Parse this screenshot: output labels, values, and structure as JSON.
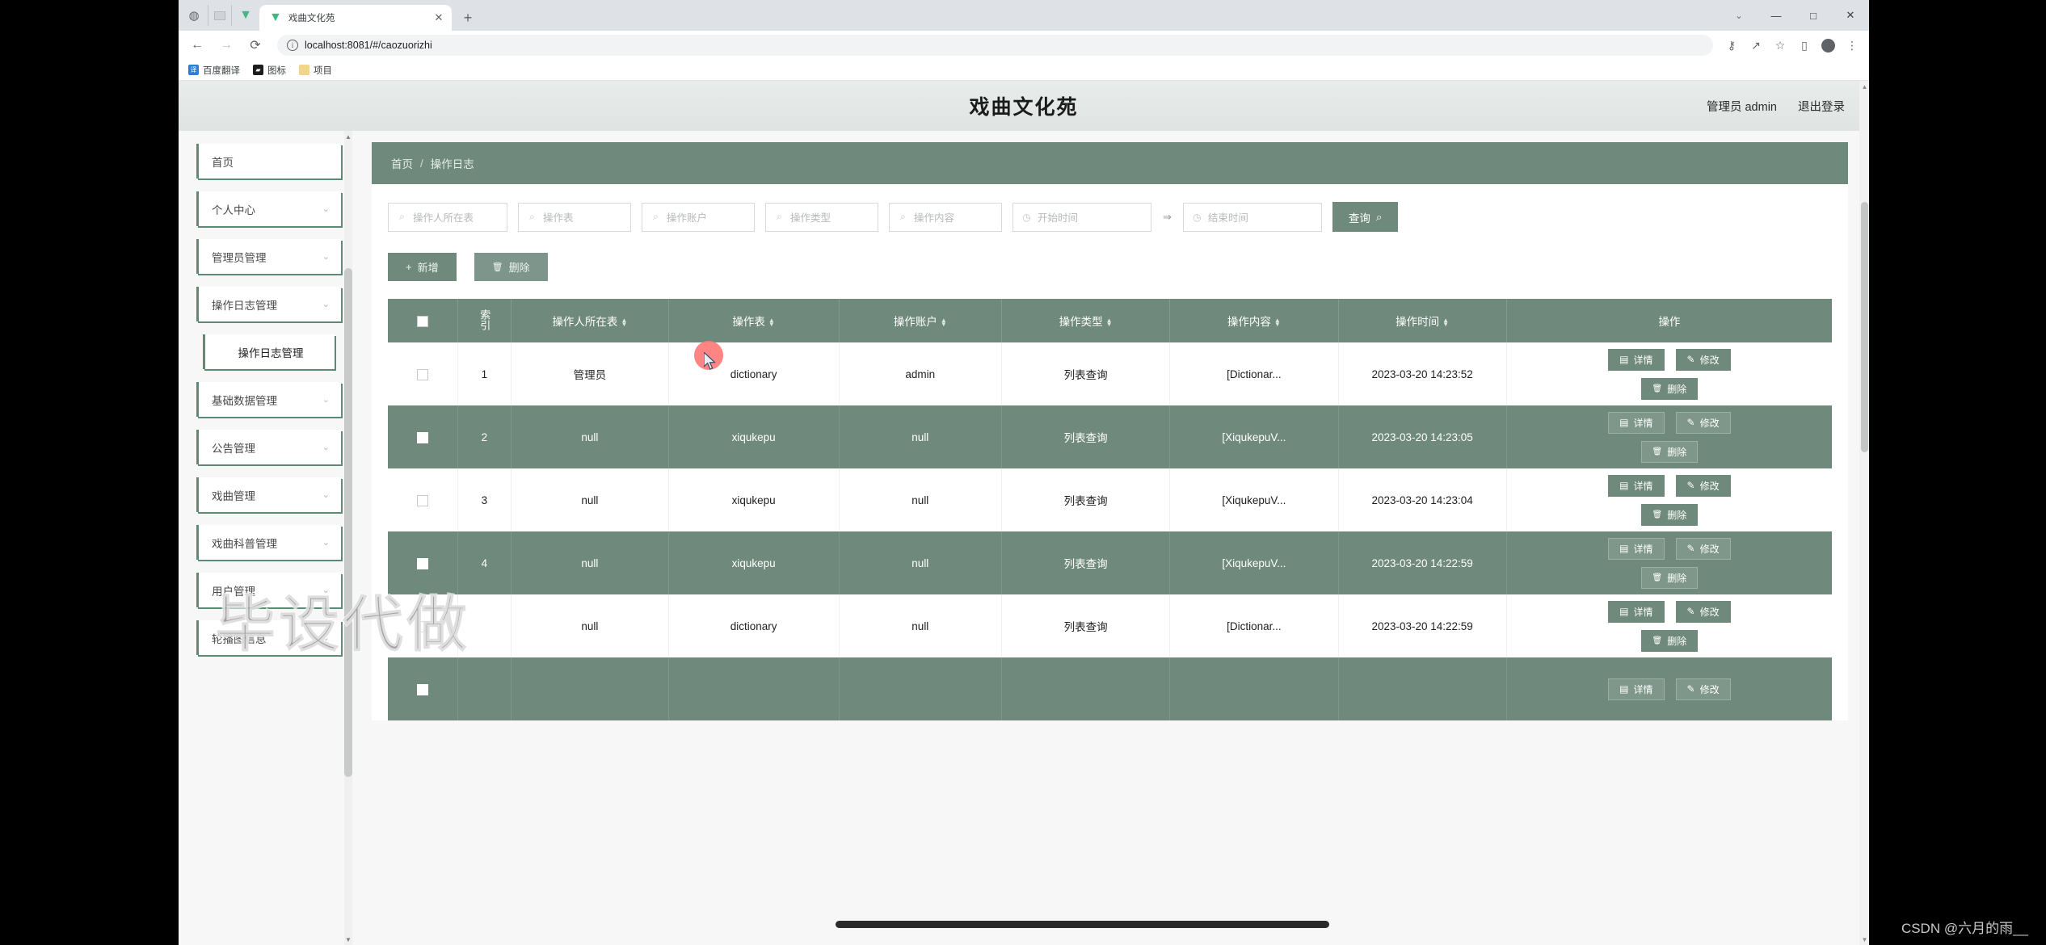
{
  "browser": {
    "tab_title": "戏曲文化苑",
    "tab_close": "✕",
    "new_tab": "+",
    "back": "←",
    "forward": "→",
    "reload": "⟳",
    "url": "localhost:8081/#/caozuorizhi",
    "info_icon": "i",
    "minimize": "—",
    "maximize": "□",
    "close": "✕",
    "chev": "⌄",
    "toolbar_icons": {
      "key": "⚷",
      "share": "↗",
      "star": "☆",
      "sidepanel": "▯",
      "profile": "●",
      "menu": "⋮"
    },
    "bookmarks": [
      {
        "label": "百度翻译",
        "icon_char": "译",
        "icon_color": "#2b7fd4"
      },
      {
        "label": "图标",
        "icon_char": "▰",
        "icon_color": "#1d1d1d"
      },
      {
        "label": "项目",
        "icon_char": "▤",
        "icon_color": "#f0d58a"
      }
    ]
  },
  "header": {
    "title": "戏曲文化苑",
    "user": "管理员 admin",
    "logout": "退出登录"
  },
  "sidebar": {
    "items": [
      {
        "label": "首页",
        "has_chevron": false,
        "sub": false
      },
      {
        "label": "个人中心",
        "has_chevron": true,
        "sub": false
      },
      {
        "label": "管理员管理",
        "has_chevron": true,
        "sub": false
      },
      {
        "label": "操作日志管理",
        "has_chevron": true,
        "sub": false
      },
      {
        "label": "操作日志管理",
        "has_chevron": false,
        "sub": true
      },
      {
        "label": "基础数据管理",
        "has_chevron": true,
        "sub": false
      },
      {
        "label": "公告管理",
        "has_chevron": true,
        "sub": false
      },
      {
        "label": "戏曲管理",
        "has_chevron": true,
        "sub": false
      },
      {
        "label": "戏曲科普管理",
        "has_chevron": true,
        "sub": false
      },
      {
        "label": "用户管理",
        "has_chevron": true,
        "sub": false
      },
      {
        "label": "轮播图信息",
        "has_chevron": true,
        "sub": false
      }
    ],
    "chevron": "⌄"
  },
  "breadcrumb": {
    "home": "首页",
    "separator": "/",
    "current": "操作日志"
  },
  "filters": {
    "fields": [
      {
        "placeholder": "操作人所在表",
        "icon": "search",
        "width": "w1"
      },
      {
        "placeholder": "操作表",
        "icon": "search",
        "width": "w2"
      },
      {
        "placeholder": "操作账户",
        "icon": "search",
        "width": "w2"
      },
      {
        "placeholder": "操作类型",
        "icon": "search",
        "width": "w2"
      },
      {
        "placeholder": "操作内容",
        "icon": "search",
        "width": "w2"
      },
      {
        "placeholder": "开始时间",
        "icon": "clock",
        "width": "date"
      }
    ],
    "range_separator": "⇒",
    "end_field": {
      "placeholder": "结束时间",
      "icon": "clock"
    },
    "search_button": "查询",
    "search_icon": "⌕"
  },
  "toolbar": {
    "add_label": "新增",
    "add_icon": "+",
    "delete_label": "删除",
    "delete_icon": "🗑"
  },
  "table": {
    "columns": [
      {
        "key": "cb",
        "label": "",
        "sortable": false,
        "vertical": false
      },
      {
        "key": "idx",
        "label": "索引",
        "sortable": false,
        "vertical": true
      },
      {
        "key": "a",
        "label": "操作人所在表",
        "sortable": true,
        "vertical": false
      },
      {
        "key": "b",
        "label": "操作表",
        "sortable": true,
        "vertical": false
      },
      {
        "key": "c",
        "label": "操作账户",
        "sortable": true,
        "vertical": false
      },
      {
        "key": "d",
        "label": "操作类型",
        "sortable": true,
        "vertical": false
      },
      {
        "key": "e",
        "label": "操作内容",
        "sortable": true,
        "vertical": false
      },
      {
        "key": "f",
        "label": "操作时间",
        "sortable": true,
        "vertical": false
      },
      {
        "key": "g",
        "label": "操作",
        "sortable": false,
        "vertical": false
      }
    ],
    "row_actions": {
      "detail": "详情",
      "detail_icon": "▤",
      "edit": "修改",
      "edit_icon": "✎",
      "delete": "删除",
      "delete_icon": "🗑"
    },
    "rows": [
      {
        "idx": "1",
        "a": "管理员",
        "b": "dictionary",
        "c": "admin",
        "d": "列表查询",
        "e": "[Dictionar...",
        "f": "2023-03-20 14:23:52"
      },
      {
        "idx": "2",
        "a": "null",
        "b": "xiqukepu",
        "c": "null",
        "d": "列表查询",
        "e": "[XiqukepuV...",
        "f": "2023-03-20 14:23:05"
      },
      {
        "idx": "3",
        "a": "null",
        "b": "xiqukepu",
        "c": "null",
        "d": "列表查询",
        "e": "[XiqukepuV...",
        "f": "2023-03-20 14:23:04"
      },
      {
        "idx": "4",
        "a": "null",
        "b": "xiqukepu",
        "c": "null",
        "d": "列表查询",
        "e": "[XiqukepuV...",
        "f": "2023-03-20 14:22:59"
      },
      {
        "idx": "",
        "a": "null",
        "b": "dictionary",
        "c": "null",
        "d": "列表查询",
        "e": "[Dictionar...",
        "f": "2023-03-20 14:22:59"
      }
    ]
  },
  "watermarks": {
    "main": "毕设代做",
    "csdn": "CSDN @六月的雨__"
  },
  "colors": {
    "accent": "#6f8a7c",
    "header_bg": "#e8eceb",
    "page_bg": "#f6f7f6"
  }
}
